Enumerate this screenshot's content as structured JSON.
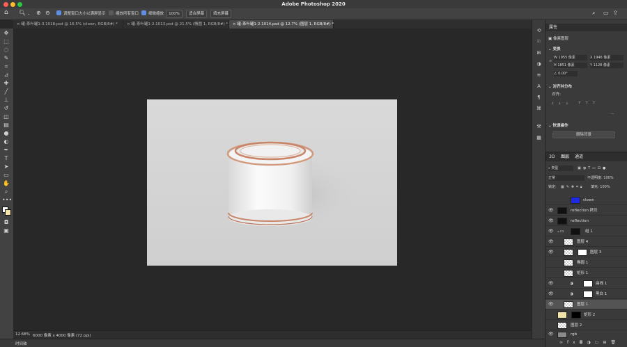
{
  "app": {
    "title": "Adobe Photoshop 2020",
    "traffic_lights": {
      "close": "#ff5f57",
      "minimize": "#febc2e",
      "zoom": "#28c840"
    }
  },
  "options_bar": {
    "resize_windows": "调整窗口大小以满屏显示",
    "zoom_all": "缩放所有窗口",
    "scrubby_zoom": "细微缩放",
    "zoom_value": "100%",
    "fit_screen": "适合屏幕",
    "fill_screen": "填充屏幕"
  },
  "tabs": [
    {
      "label": "罐-茶叶罐1-3.1018.psd @ 16.5% (clown, RGB/8#) *"
    },
    {
      "label": "罐-茶叶罐1-2.1013.psd @ 21.5% (椭圆 1, RGB/8#) *"
    },
    {
      "label": "罐-茶叶罐1-2.1014.psd @ 12.7% (图层 1, RGB/8#) *"
    }
  ],
  "status": {
    "zoom": "12.68%",
    "doc_info": "6000 像素 x 4000 像素 (72 ppi)"
  },
  "timeline": {
    "label": "时间轴"
  },
  "properties": {
    "tab": "属性",
    "layer_type": "像素图层",
    "transform_title": "变换",
    "w": "W  1955 像素",
    "x": "X  1946 像素",
    "h": "H  1851 像素",
    "y": "Y  1128 像素",
    "angle": "0.00°",
    "align_title": "对齐并分布",
    "align_label": "对齐:",
    "quick_title": "快速操作",
    "remove_bg": "删除背景"
  },
  "layers_panel": {
    "tabs": [
      "3D",
      "图层",
      "通道"
    ],
    "filter": "类型",
    "blend": "正常",
    "opacity": "不透明度: 100%",
    "lock": "锁定:",
    "fill": "填充: 100%",
    "layers": [
      {
        "name": "clown"
      },
      {
        "name": "reflection 拷贝"
      },
      {
        "name": "reflection"
      },
      {
        "name": "组 1"
      },
      {
        "name": "图层 4"
      },
      {
        "name": "图层 3"
      },
      {
        "name": "椭圆 1"
      },
      {
        "name": "矩形 1"
      },
      {
        "name": "曲线 1"
      },
      {
        "name": "黑白 1"
      },
      {
        "name": "图层 1"
      },
      {
        "name": "矩形 2"
      },
      {
        "name": "图层 2"
      },
      {
        "name": "rgb"
      }
    ]
  },
  "icons": [
    "home-icon",
    "zoom-tool-icon",
    "zoom-in-icon",
    "zoom-out-icon",
    "move-tool-icon",
    "marquee-tool-icon",
    "lasso-tool-icon",
    "quick-select-icon",
    "crop-tool-icon",
    "eyedropper-icon",
    "healing-brush-icon",
    "brush-tool-icon",
    "clone-stamp-icon",
    "history-brush-icon",
    "eraser-icon",
    "gradient-tool-icon",
    "blur-tool-icon",
    "dodge-tool-icon",
    "pen-tool-icon",
    "type-tool-icon",
    "path-select-icon",
    "rectangle-tool-icon",
    "hand-tool-icon",
    "zoom-tool-icon-2",
    "more-tools-icon",
    "color-swatch-icon",
    "quick-mask-icon",
    "screen-mode-icon",
    "search-icon",
    "workspace-icon",
    "share-icon",
    "eye-icon",
    "link-icon",
    "fx-icon",
    "adjustment-icon",
    "folder-icon",
    "new-layer-icon",
    "trash-icon"
  ]
}
